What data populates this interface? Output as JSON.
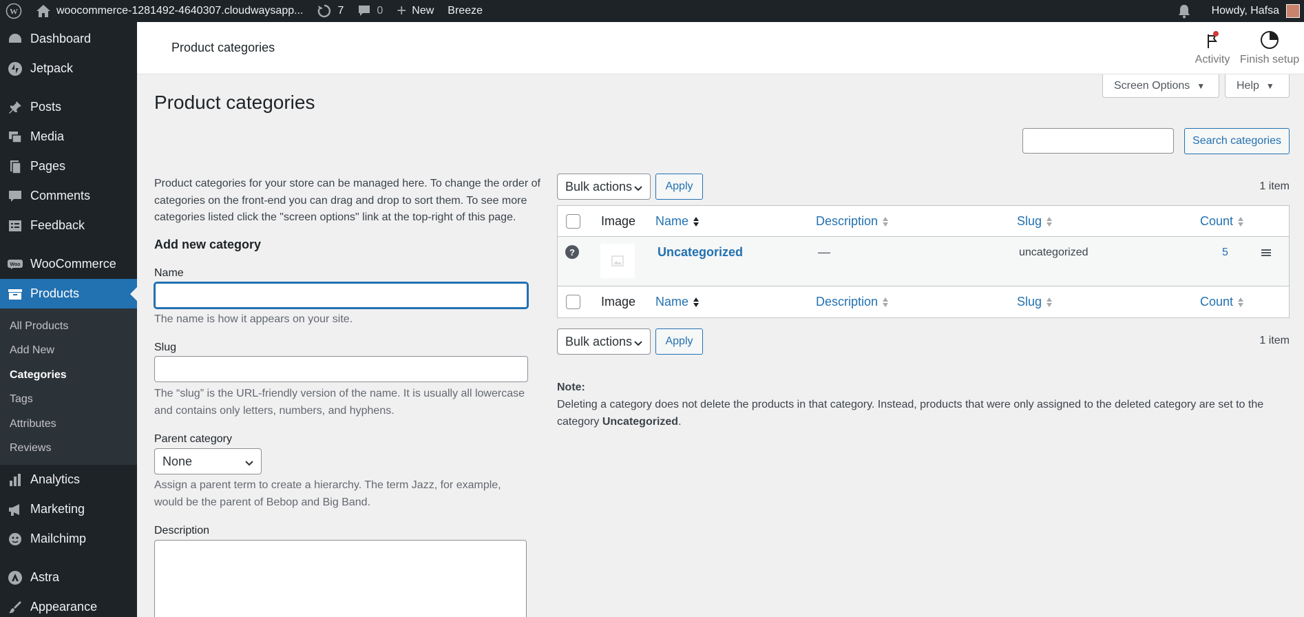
{
  "adminbar": {
    "site_name": "woocommerce-1281492-4640307.cloudwaysapp...",
    "updates_count": "7",
    "comments_count": "0",
    "new_label": "New",
    "breeze_label": "Breeze",
    "howdy": "Howdy, Hafsa"
  },
  "sidebar": {
    "items": [
      {
        "label": "Dashboard"
      },
      {
        "label": "Jetpack"
      },
      {
        "label": "Posts"
      },
      {
        "label": "Media"
      },
      {
        "label": "Pages"
      },
      {
        "label": "Comments"
      },
      {
        "label": "Feedback"
      },
      {
        "label": "WooCommerce"
      },
      {
        "label": "Products"
      },
      {
        "label": "Analytics"
      },
      {
        "label": "Marketing"
      },
      {
        "label": "Mailchimp"
      },
      {
        "label": "Astra"
      },
      {
        "label": "Appearance"
      }
    ],
    "submenu": [
      "All Products",
      "Add New",
      "Categories",
      "Tags",
      "Attributes",
      "Reviews"
    ]
  },
  "header": {
    "title": "Product categories",
    "activity_label": "Activity",
    "finish_setup_label": "Finish setup"
  },
  "screen_options_label": "Screen Options",
  "help_label": "Help",
  "page_title": "Product categories",
  "search": {
    "button_label": "Search categories",
    "value": ""
  },
  "intro_text": "Product categories for your store can be managed here. To change the order of categories on the front-end you can drag and drop to sort them. To see more categories listed click the \"screen options\" link at the top-right of this page.",
  "form": {
    "heading": "Add new category",
    "name_label": "Name",
    "name_hint": "The name is how it appears on your site.",
    "slug_label": "Slug",
    "slug_hint": "The “slug” is the URL-friendly version of the name. It is usually all lowercase and contains only letters, numbers, and hyphens.",
    "parent_label": "Parent category",
    "parent_value": "None",
    "parent_hint": "Assign a parent term to create a hierarchy. The term Jazz, for example, would be the parent of Bebop and Big Band.",
    "description_label": "Description"
  },
  "table": {
    "bulk_actions_label": "Bulk actions",
    "apply_label": "Apply",
    "item_count": "1 item",
    "columns": {
      "image": "Image",
      "name": "Name",
      "description": "Description",
      "slug": "Slug",
      "count": "Count"
    },
    "rows": [
      {
        "name": "Uncategorized",
        "description": "—",
        "slug": "uncategorized",
        "count": "5"
      }
    ]
  },
  "note": {
    "label": "Note:",
    "text": "Deleting a category does not delete the products in that category. Instead, products that were only assigned to the deleted category are set to the category",
    "bold": "Uncategorized",
    "end": "."
  },
  "colors": {
    "accent": "#2271b1",
    "sidebar_bg": "#1d2327",
    "page_bg": "#f0f0f1"
  }
}
